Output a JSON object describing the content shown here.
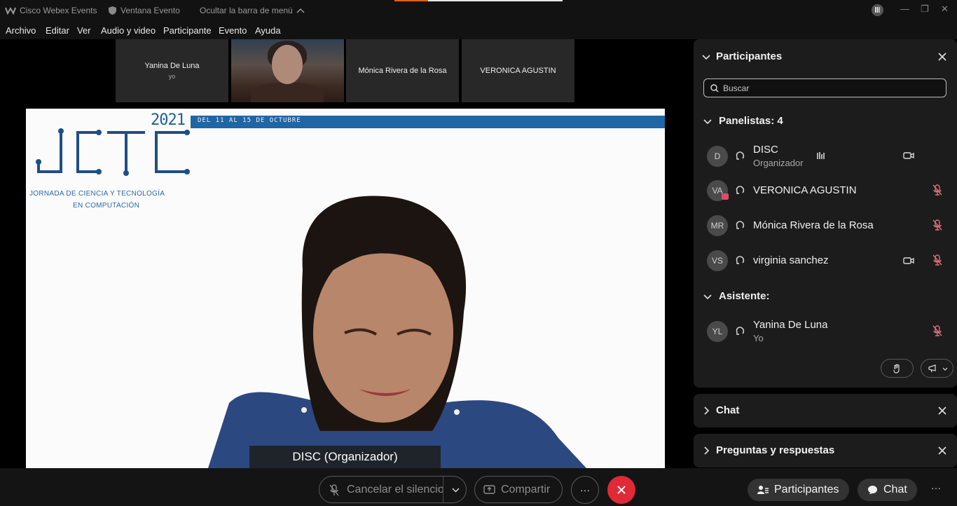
{
  "titlebar": {
    "app_name": "Cisco Webex Events",
    "window_label": "Ventana Evento",
    "hide_menu_label": "Ocultar la barra de menú"
  },
  "menu": [
    "Archivo",
    "Editar",
    "Ver",
    "Audio y video",
    "Participante",
    "Evento",
    "Ayuda"
  ],
  "thumbnails": [
    {
      "name": "Yanina De Luna",
      "sub": "yo"
    },
    {
      "name": "",
      "sub": "",
      "video": true
    },
    {
      "name": "Mónica Rivera de la Rosa",
      "sub": ""
    },
    {
      "name": "VERONICA AGUSTIN",
      "sub": ""
    }
  ],
  "stage": {
    "year": "2021",
    "banner": "DEL 11 AL 15 DE OCTUBRE",
    "logo_text": "JCTC",
    "logo_line1": "JORNADA DE CIENCIA Y TECNOLOGÍA",
    "logo_line2": "EN COMPUTACIÓN",
    "caption": "DISC (Organizador)"
  },
  "participants_panel": {
    "title": "Participantes",
    "search_placeholder": "Buscar",
    "panelists_label": "Panelistas: 4",
    "attendees_label": "Asistente:",
    "panelists": [
      {
        "initials": "D",
        "name": "DISC",
        "role": "Organizador",
        "mic": "active",
        "video": true
      },
      {
        "initials": "VA",
        "name": "VERONICA AGUSTIN",
        "role": "",
        "mic": "muted",
        "video": false
      },
      {
        "initials": "MR",
        "name": "Mónica Rivera de la Rosa",
        "role": "",
        "mic": "muted",
        "video": false
      },
      {
        "initials": "VS",
        "name": "virginia sanchez",
        "role": "",
        "mic": "muted",
        "video": true
      }
    ],
    "attendees": [
      {
        "initials": "YL",
        "name": "Yanina De Luna",
        "role": "Yo",
        "mic": "muted"
      }
    ]
  },
  "chat_panel": {
    "title": "Chat"
  },
  "qa_panel": {
    "title": "Preguntas y respuestas"
  },
  "bottombar": {
    "unmute_label": "Cancelar el silencio",
    "share_label": "Compartir",
    "more_label": "···",
    "participants_label": "Participantes",
    "chat_label": "Chat",
    "overflow_label": "···"
  },
  "colors": {
    "accent_red": "#e02a35",
    "muted_mic": "#e0707a",
    "panel_bg": "#1c1c1c",
    "banner_blue": "#1e66a6"
  }
}
